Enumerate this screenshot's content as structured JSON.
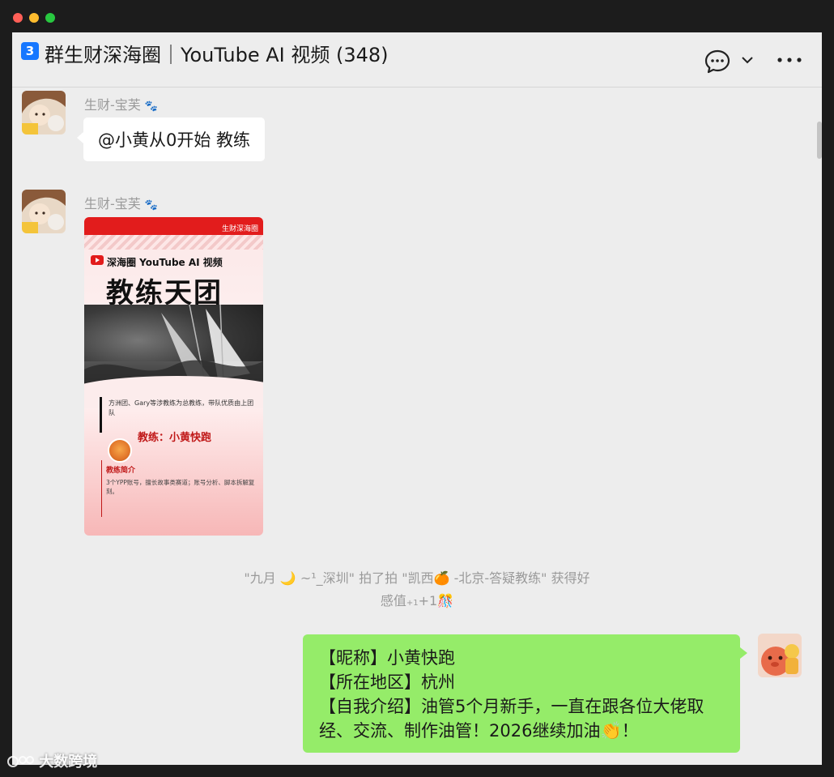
{
  "header": {
    "badge": "3",
    "title": "群生财深海圈｜YouTube AI 视频 (348)"
  },
  "messages": [
    {
      "sender": "生财-宝芙",
      "sender_emoji": "🐾",
      "text": "@小黄从0开始 教练"
    },
    {
      "sender": "生财-宝芙",
      "sender_emoji": "🐾",
      "poster": {
        "brand": "生财深海圈",
        "subtitle": "深海圈 YouTube AI 视频",
        "headline": "教练天团",
        "desc": "方洲团、Gary等涉教练为总教练，带队优质由上团队",
        "coach": "教练：小黄快跑",
        "intro_title": "教练简介",
        "intro_text": "3个YPP账号，擅长故事类赛道；账号分析、脚本拆解复刻。"
      }
    }
  ],
  "system_note": {
    "line1": "\"九月 🌙 ~¹_深圳\" 拍了拍 \"凯西🍊 -北京-答疑教练\" 获得好",
    "line2_main": "感值",
    "line2_sub": "+1",
    "line2_tail": "+1🎊"
  },
  "own_message": {
    "lines": [
      "【昵称】小黄快跑",
      "【所在地区】杭州",
      "【自我介绍】油管5个月新手，一直在跟各位大佬取",
      "经、交流、制作油管！2026继续加油👏！"
    ]
  },
  "watermark": "大数跨境"
}
